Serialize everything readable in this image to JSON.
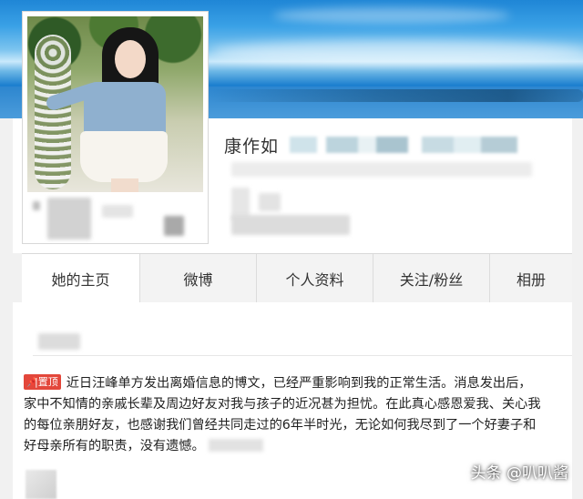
{
  "profile": {
    "name": "康作如"
  },
  "tabs": [
    {
      "label": "她的主页",
      "active": true
    },
    {
      "label": "微博",
      "active": false
    },
    {
      "label": "个人资料",
      "active": false
    },
    {
      "label": "关注/粉丝",
      "active": false
    },
    {
      "label": "相册",
      "active": false
    }
  ],
  "post": {
    "pin_badge": "置顶",
    "pin_icon": "pin-icon",
    "lines": [
      "近日汪峰单方发出离婚信息的博文，已经严重影响到我的正常生活。消息发出后，",
      "家中不知情的亲戚长辈及周边好友对我与孩子的近况甚为担忧。在此真心感恩爱我、关心我",
      "的每位亲朋好友，也感谢我们曾经共同走过的6年半时光，无论如何我尽到了一个好妻子和",
      "好母亲所有的职责，没有遗憾。"
    ]
  },
  "watermark": "头条 @叭叭酱",
  "colors": {
    "pin_red": "#e3473b",
    "banner_blue": "#2d8fd8"
  }
}
